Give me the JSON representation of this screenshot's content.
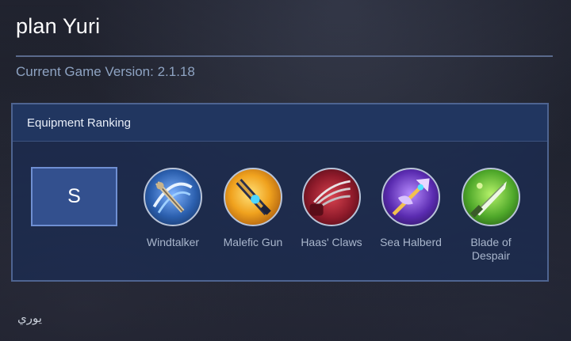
{
  "header": {
    "title": "plan Yuri",
    "version_label": "Current Game Version: 2.1.18"
  },
  "panel": {
    "heading": "Equipment Ranking",
    "tier": "S",
    "items": [
      {
        "label": "Windtalker",
        "icon": "windtalker-icon"
      },
      {
        "label": "Malefic Gun",
        "icon": "malefic-gun-icon"
      },
      {
        "label": "Haas' Claws",
        "icon": "haas-claws-icon"
      },
      {
        "label": "Sea Halberd",
        "icon": "sea-halberd-icon"
      },
      {
        "label": "Blade of Despair",
        "icon": "blade-of-despair-icon"
      }
    ]
  },
  "footer": {
    "text": "يوري"
  },
  "colors": {
    "panel_border": "#4e6491",
    "tier_bg": "#33508e",
    "version_text": "#8ea3c2"
  }
}
